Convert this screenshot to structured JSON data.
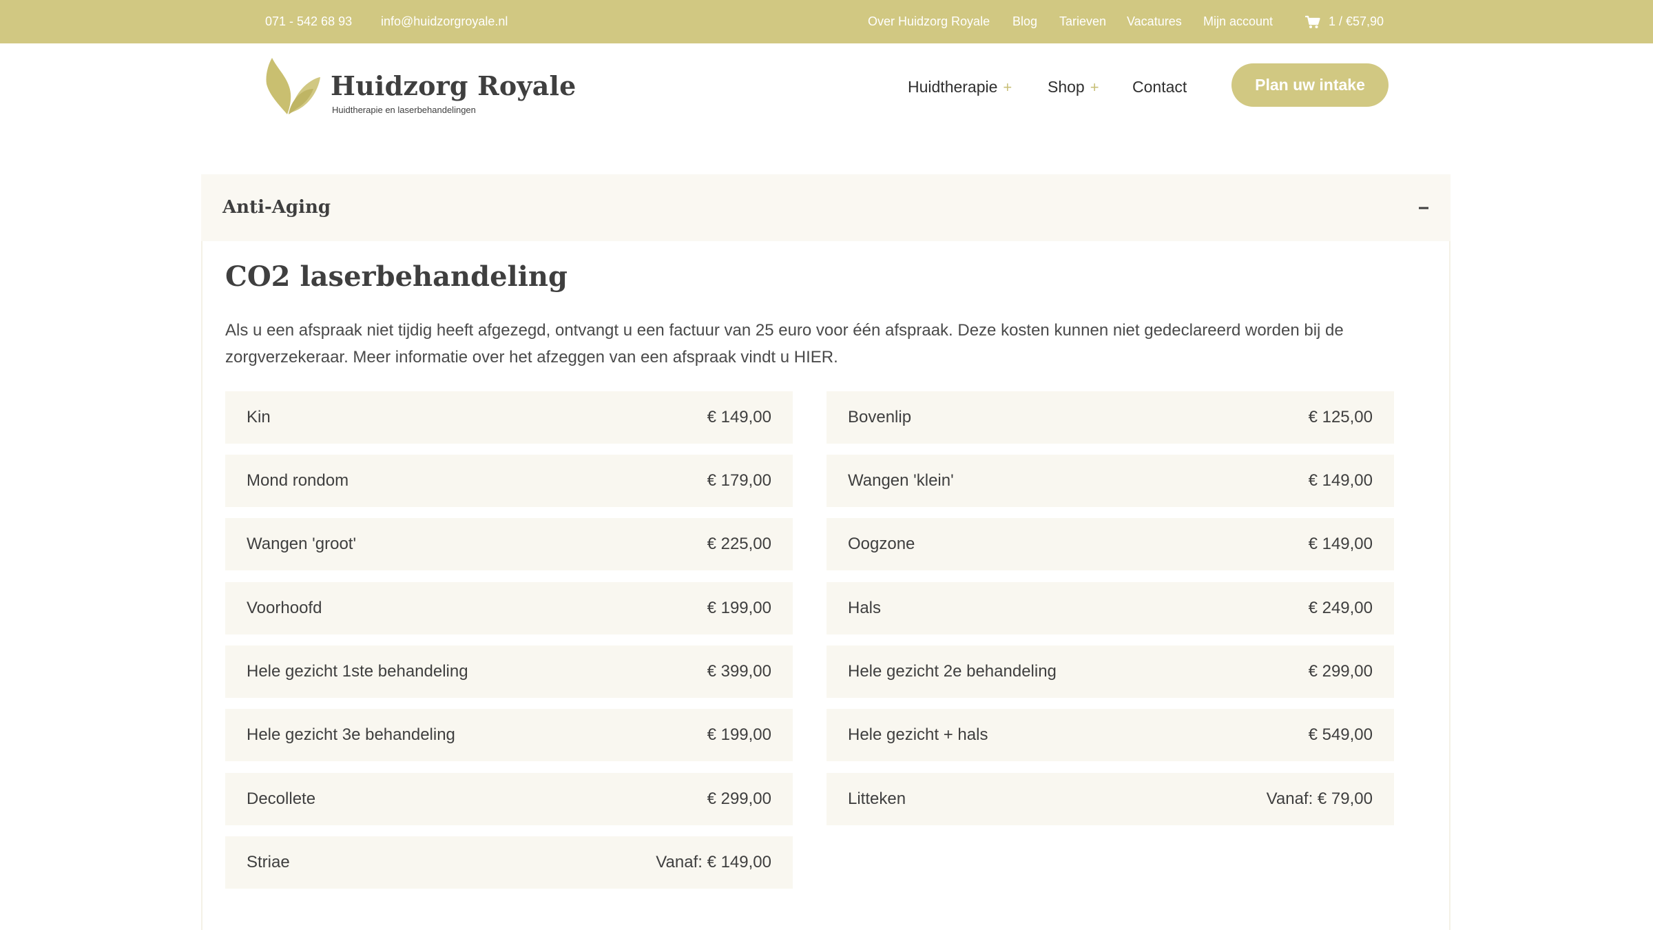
{
  "topbar": {
    "phone": "071 - 542 68 93",
    "email": "info@huidzorgroyale.nl",
    "links": [
      "Over Huidzorg Royale",
      "Blog",
      "Tarieven",
      "Vacatures",
      "Mijn account"
    ],
    "cart": "1 / €57,90"
  },
  "logo": {
    "brand": "Huidzorg Royale",
    "tagline": "Huidtherapie en laserbehandelingen"
  },
  "nav": {
    "items": [
      "Huidtherapie",
      "Shop",
      "Contact"
    ],
    "plus": "+",
    "cta": "Plan uw intake"
  },
  "accordion": {
    "title": "Anti-Aging"
  },
  "section": {
    "title": "CO2 laserbehandeling",
    "intro": "Als u een afspraak niet tijdig heeft afgezegd, ontvangt u een factuur van 25 euro voor één afspraak. Deze kosten kunnen niet gedeclareerd worden bij de zorgverzekeraar. Meer informatie over het afzeggen van een afspraak vindt u HIER."
  },
  "prices": {
    "left": [
      {
        "label": "Kin",
        "value": "€ 149,00"
      },
      {
        "label": "Mond rondom",
        "value": "€ 179,00"
      },
      {
        "label": "Wangen 'groot'",
        "value": "€ 225,00"
      },
      {
        "label": "Voorhoofd",
        "value": "€ 199,00"
      },
      {
        "label": "Hele gezicht 1ste behandeling",
        "value": "€ 399,00"
      },
      {
        "label": "Hele gezicht 3e behandeling",
        "value": "€ 199,00"
      },
      {
        "label": "Decollete",
        "value": "€ 299,00"
      },
      {
        "label": "Striae",
        "value": "Vanaf: € 149,00"
      }
    ],
    "right": [
      {
        "label": "Bovenlip",
        "value": "€ 125,00"
      },
      {
        "label": "Wangen 'klein'",
        "value": "€ 149,00"
      },
      {
        "label": "Oogzone",
        "value": "€ 149,00"
      },
      {
        "label": "Hals",
        "value": "€ 249,00"
      },
      {
        "label": "Hele gezicht 2e behandeling",
        "value": "€ 299,00"
      },
      {
        "label": "Hele gezicht + hals",
        "value": "€ 549,00"
      },
      {
        "label": "Litteken",
        "value": "Vanaf: € 79,00"
      }
    ]
  },
  "colors": {
    "accent": "#d1c882",
    "row_bg": "#f9f7f0",
    "text": "#3f3f3f"
  }
}
